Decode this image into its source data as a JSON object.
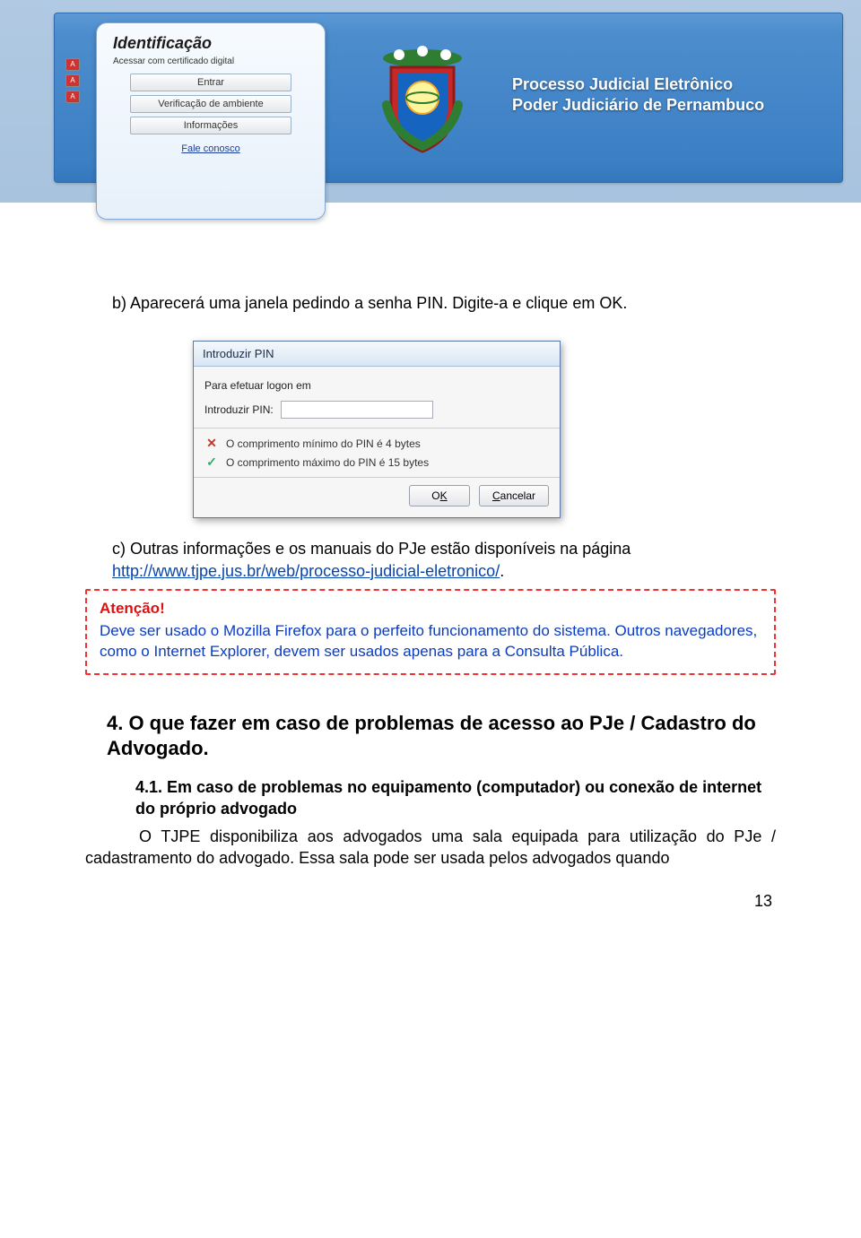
{
  "banner": {
    "login": {
      "title": "Identificação",
      "subtitle": "Acessar com certificado digital",
      "btn_entrar": "Entrar",
      "btn_verif": "Verificação de ambiente",
      "btn_info": "Informações",
      "link_fale": "Fale conosco"
    },
    "line1": "Processo Judicial Eletrônico",
    "line2": "Poder Judiciário de Pernambuco"
  },
  "para_b": "b) Aparecerá uma janela pedindo a senha PIN. Digite-a e clique em OK.",
  "dialog": {
    "title": "Introduzir PIN",
    "row1": "Para efetuar logon em",
    "row2_label": "Introduzir PIN:",
    "rule_min": "O comprimento mínimo do PIN é 4 bytes",
    "rule_max": "O comprimento máximo do PIN é 15 bytes",
    "ok_pre": "O",
    "ok_u": "K",
    "cancel_u": "C",
    "cancel_post": "ancelar"
  },
  "para_c_pre": "c) Outras informações e os manuais do PJe estão disponíveis na página ",
  "para_c_link": "http://www.tjpe.jus.br/web/processo-judicial-eletronico/",
  "para_c_post": ".",
  "alert": {
    "title": "Atenção!",
    "body": "Deve ser usado o Mozilla Firefox para o perfeito funcionamento do sistema. Outros navegadores, como o Internet Explorer, devem ser usados apenas para a Consulta Pública."
  },
  "section4_title": "4. O que fazer em caso de problemas de acesso ao PJe / Cadastro do Advogado.",
  "sub41": "4.1. Em caso de problemas no equipamento (computador) ou conexão de internet do próprio advogado",
  "body41": "O TJPE disponibiliza aos advogados uma sala equipada para utilização do PJe / cadastramento do advogado. Essa sala pode ser usada pelos advogados quando",
  "page_number": "13"
}
